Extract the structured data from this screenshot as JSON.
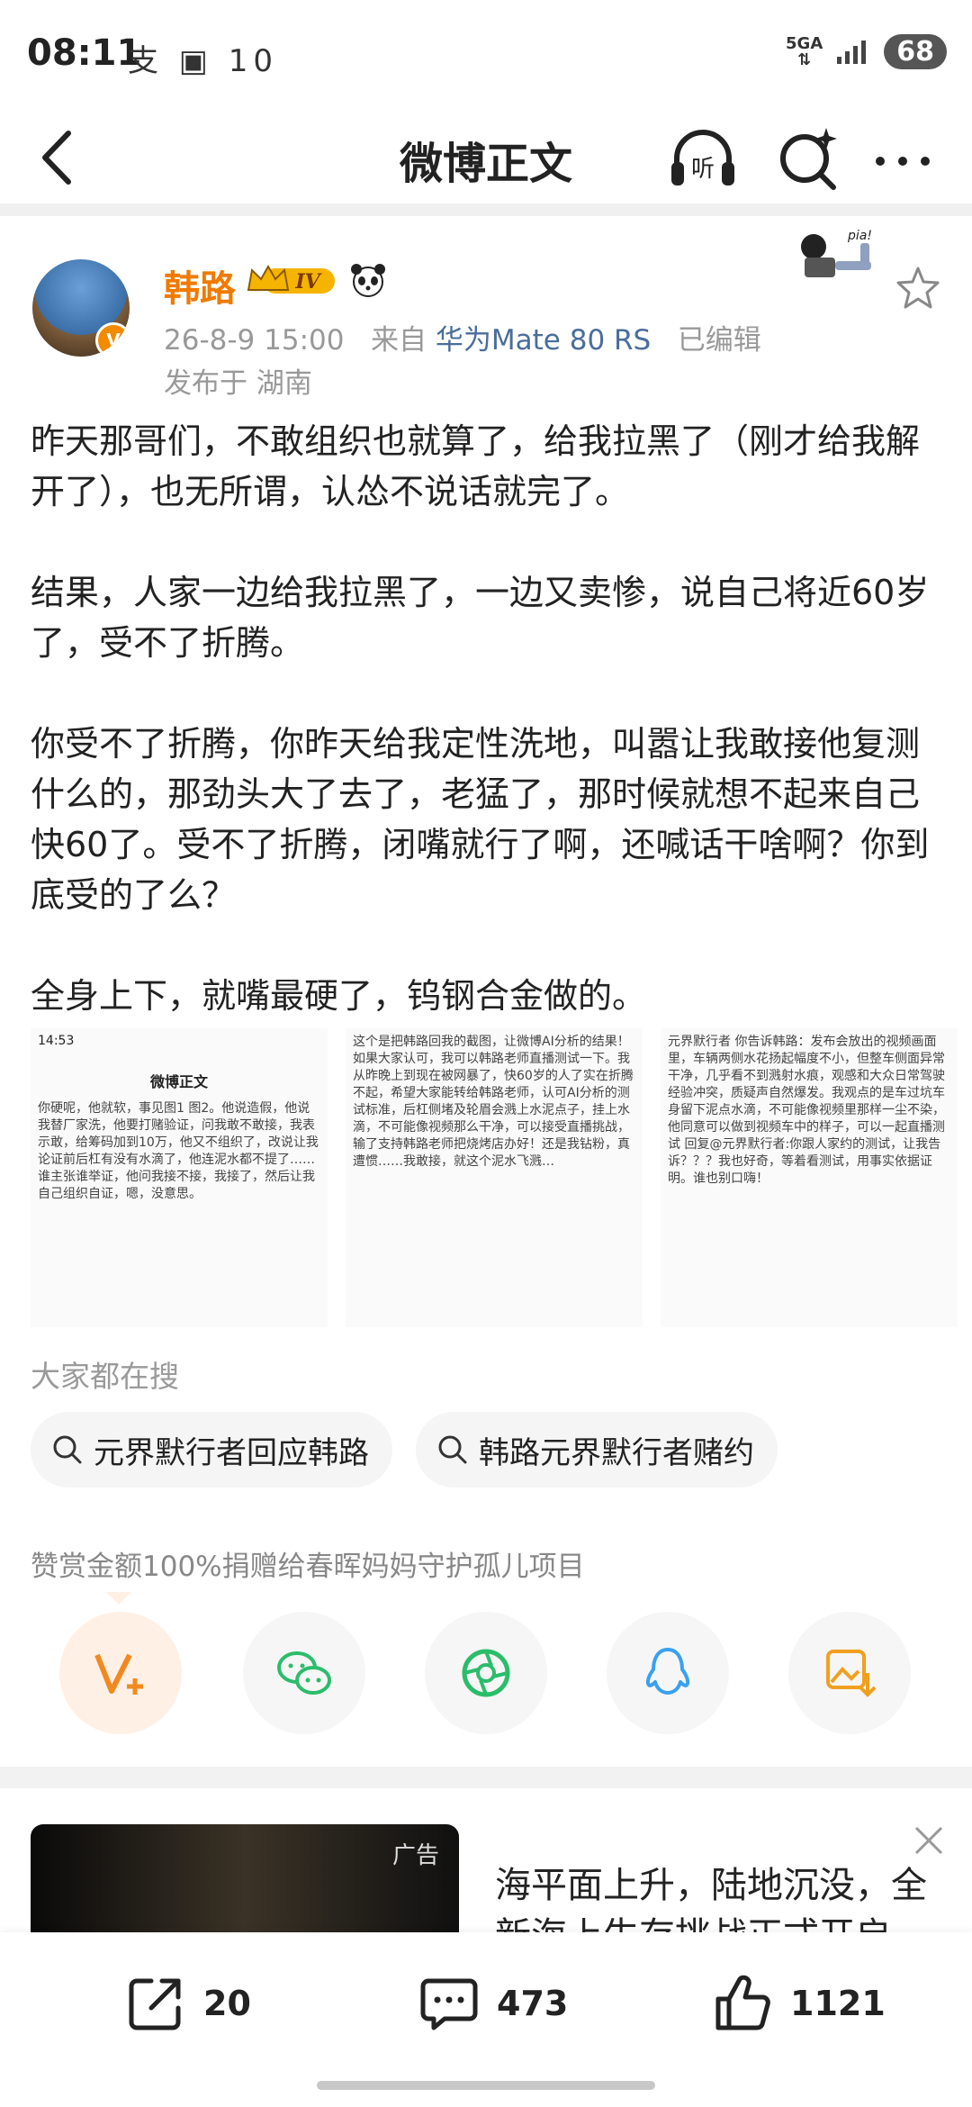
{
  "status_bar": {
    "time": "08:11",
    "icons_left": "支 ▣ 10",
    "network": "5GA",
    "battery": "68"
  },
  "nav": {
    "title": "微博正文"
  },
  "post": {
    "author": "韩路",
    "level_badge": "IV",
    "date": "26-8-9 15:00",
    "source_prefix": "来自",
    "device": "华为Mate 80 RS",
    "edited": "已编辑",
    "location": "发布于 湖南",
    "paragraphs": [
      "昨天那哥们，不敢组织也就算了，给我拉黑了（刚才给我解开了），也无所谓，认怂不说话就完了。",
      "结果，人家一边给我拉黑了，一边又卖惨，说自己将近60岁了，受不了折腾。",
      "你受不了折腾，你昨天给我定性洗地，叫嚣让我敢接他复测什么的，那劲头大了去了，老猛了，那时候就想不起来自己快60了。受不了折腾，闭嘴就行了啊，还喊话干啥啊？你到底受的了么？",
      "全身上下，就嘴最硬了，钨钢合金做的。"
    ],
    "thumbs": [
      {
        "status": "14:53",
        "nav": "微博正文",
        "text": "你硬呢，他就软，事见图1 图2。他说造假，他说我替厂家洗，他要打赌验证，问我敢不敢接，我表示敢，给筹码加到10万，他又不组织了，改说让我论证前后杠有没有水滴了，他连泥水都不提了……谁主张谁举证，他问我接不接，我接了，然后让我自己组织自证，嗯，没意思。"
      },
      {
        "text": "这个是把韩路回我的截图，让微博AI分析的结果！如果大家认可，我可以韩路老师直播测试一下。我从昨晚上到现在被网暴了，快60岁的人了实在折腾不起，希望大家能转给韩路老师，认可AI分析的测试标准，后杠侧堵及轮眉会溅上水泥点子，挂上水滴，不可能像视频那么干净，可以接受直播挑战，输了支持韩路老师把烧烤店办好！还是我钻粉，真遭惯……我敢接，就这个泥水飞溅…"
      },
      {
        "text": "元界默行者 你告诉韩路：发布会放出的视频画面里，车辆两侧水花扬起幅度不小，但整车侧面异常干净，几乎看不到溅射水痕，观感和大众日常驾驶经验冲突，质疑声自然爆发。我观点的是车过坑车身留下泥点水滴，不可能像视频里那样一尘不染，他同意可以做到视频车中的样子，可以一起直播测试 回复@元界默行者:你跟人家约的测试，让我告诉？？？我也好奇，等着看测试，用事实依据证明。谁也别口嗨！"
      }
    ]
  },
  "hot_search": {
    "title": "大家都在搜",
    "items": [
      "元界默行者回应韩路",
      "韩路元界默行者赌约"
    ]
  },
  "reward_note": "赞赏金额100%捐赠给春晖妈妈守护孤儿项目",
  "ad": {
    "label": "广告",
    "text": "海平面上升，陆地沉没，全新海上生存挑战正式开启"
  },
  "actions": {
    "repost": "20",
    "comment": "473",
    "like": "1121"
  },
  "colors": {
    "accent": "#f07a00",
    "link": "#4a6e9a",
    "wechat": "#2bbd6a",
    "qq": "#3aa0f0",
    "save": "#f0a020"
  }
}
